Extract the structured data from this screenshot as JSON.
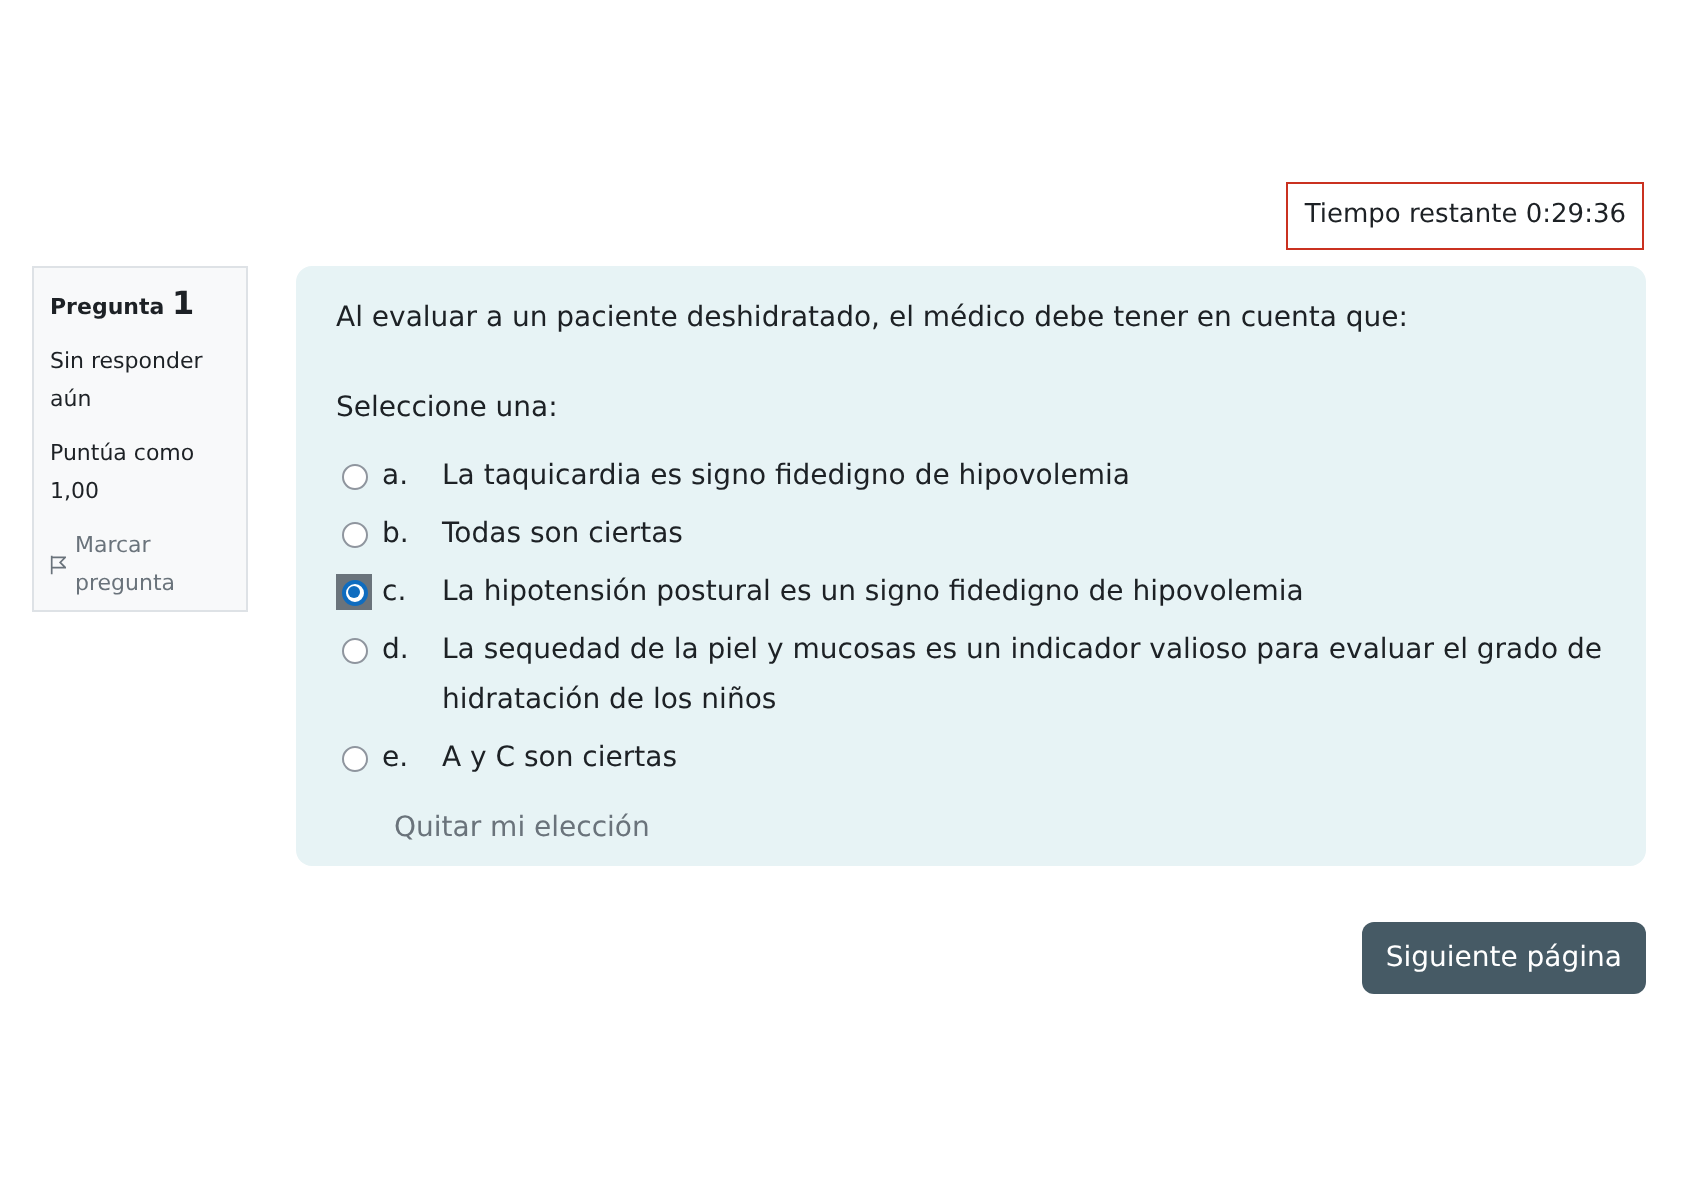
{
  "timer": {
    "label": "Tiempo restante",
    "value": "0:29:36"
  },
  "info": {
    "title": "Pregunta",
    "number": "1",
    "status": "Sin responder aún",
    "grade": "Puntúa como 1,00",
    "flag": "Marcar pregunta"
  },
  "question": {
    "text": "Al evaluar a un paciente deshidratado, el médico debe tener en cuenta que:",
    "prompt": "Seleccione una:",
    "options": [
      {
        "letter": "a.",
        "text": "La taquicardia es signo fidedigno de hipovolemia",
        "selected": false
      },
      {
        "letter": "b.",
        "text": "Todas son ciertas",
        "selected": false
      },
      {
        "letter": "c.",
        "text": "La hipotensión postural es un signo fidedigno de hipovolemia",
        "selected": true
      },
      {
        "letter": "d.",
        "text": "La sequedad de la piel y mucosas es un indicador valioso para evaluar el grado de hidratación de los niños",
        "selected": false
      },
      {
        "letter": "e.",
        "text": "A y C son ciertas",
        "selected": false
      }
    ],
    "clear": "Quitar mi elección"
  },
  "next_button": "Siguiente página"
}
